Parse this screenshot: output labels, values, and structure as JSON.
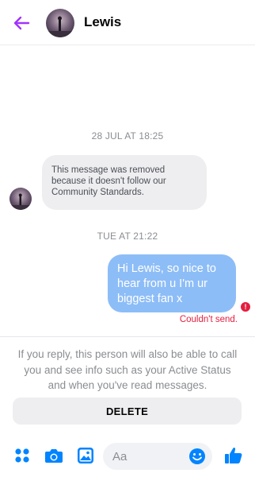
{
  "header": {
    "contact_name": "Lewis",
    "back_icon": "arrow-left-icon",
    "avatar": "profile-photo"
  },
  "thread": {
    "timestamp_1": "28 JUL AT 18:25",
    "removed_message": "This message was removed because it doesn't follow our Community Standards.",
    "timestamp_2": "TUE AT 21:22",
    "sent_message": "Hi Lewis, so nice to hear from u I'm ur biggest fan x",
    "send_error": "Couldn't send."
  },
  "notice": {
    "text": "If you reply, this person will also be able to call you and see info such as your Active Status and when you've read messages."
  },
  "actions": {
    "delete_label": "DELETE"
  },
  "composer": {
    "placeholder": "Aa",
    "icons": [
      "apps-icon",
      "camera-icon",
      "gallery-icon",
      "emoji-icon",
      "thumbs-up-icon"
    ]
  },
  "colors": {
    "accent": "#0084ff",
    "back_arrow": "#a033ff",
    "sent_bubble": "#8dbdf7",
    "error": "#e41e3f"
  }
}
